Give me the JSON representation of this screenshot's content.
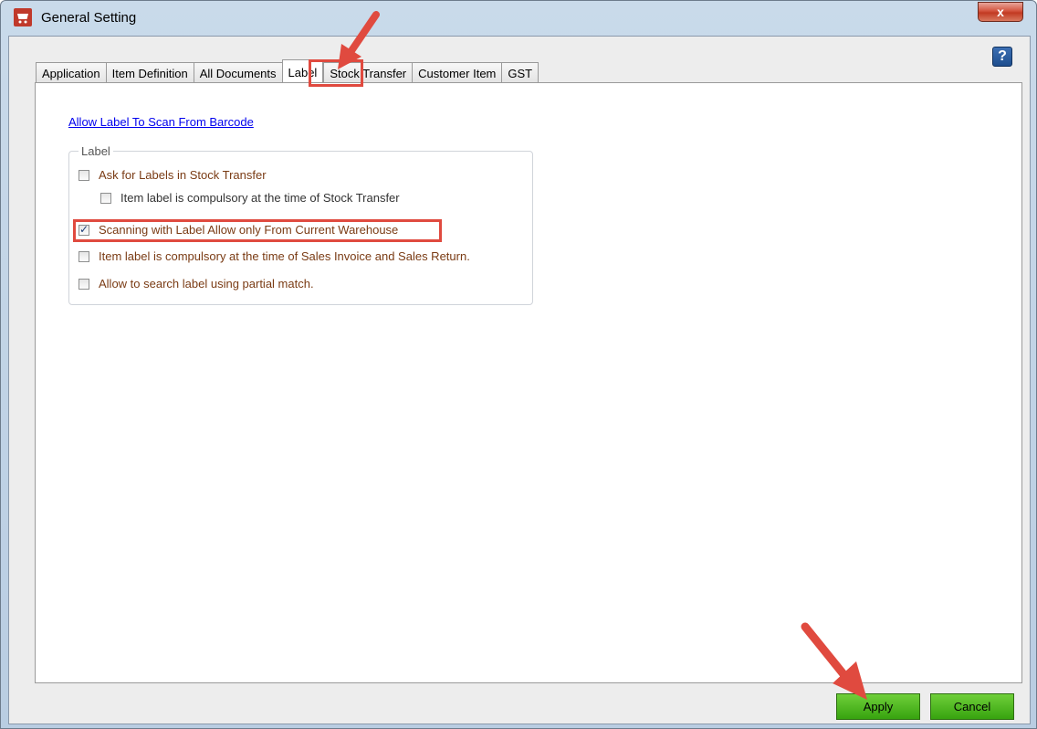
{
  "window": {
    "title": "General Setting",
    "close_label": "x",
    "help_label": "?"
  },
  "tabs": [
    {
      "label": "Application"
    },
    {
      "label": "Item Definition"
    },
    {
      "label": "All Documents"
    },
    {
      "label": "Label",
      "active": true
    },
    {
      "label": "Stock Transfer"
    },
    {
      "label": "Customer Item"
    },
    {
      "label": "GST"
    }
  ],
  "panel": {
    "link_label": "Allow Label To Scan From Barcode",
    "group_title": "Label",
    "options": [
      {
        "label": "Ask for Labels in Stock Transfer",
        "checked": false
      },
      {
        "label": "Item label is compulsory at the time of Stock Transfer",
        "checked": false
      },
      {
        "label": "Scanning with Label Allow only From Current Warehouse",
        "checked": true
      },
      {
        "label": "Item label is compulsory at the time of Sales Invoice and Sales Return.",
        "checked": false
      },
      {
        "label": "Allow to search label using partial match.",
        "checked": false
      }
    ]
  },
  "buttons": {
    "apply": "Apply",
    "cancel": "Cancel"
  },
  "colors": {
    "annotation_red": "#e04a3f",
    "button_green": "#37a30f",
    "option_text": "#7a3b14"
  }
}
